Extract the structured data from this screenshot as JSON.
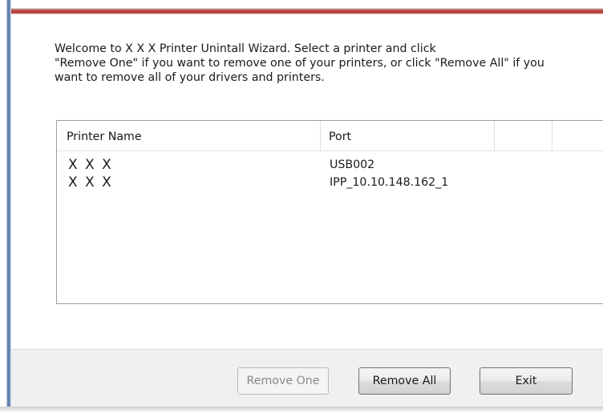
{
  "wizard": {
    "intro_text": "Welcome to X X X Printer Unintall Wizard. Select a printer and click\n\"Remove One\" if you want to remove one of your printers, or click \"Remove All\" if you\nwant to remove all of your drivers and printers."
  },
  "printer_list": {
    "columns": [
      "Printer Name",
      "Port",
      ""
    ],
    "rows": [
      {
        "name": "X X X",
        "port": "USB002"
      },
      {
        "name": "X X X",
        "port": "IPP_10.10.148.162_1"
      }
    ]
  },
  "buttons": {
    "remove_one": "Remove One",
    "remove_one_enabled": false,
    "remove_all": "Remove All",
    "exit": "Exit"
  },
  "colors": {
    "title_accent": "#c74a40",
    "frame_accent": "#5678a8"
  }
}
